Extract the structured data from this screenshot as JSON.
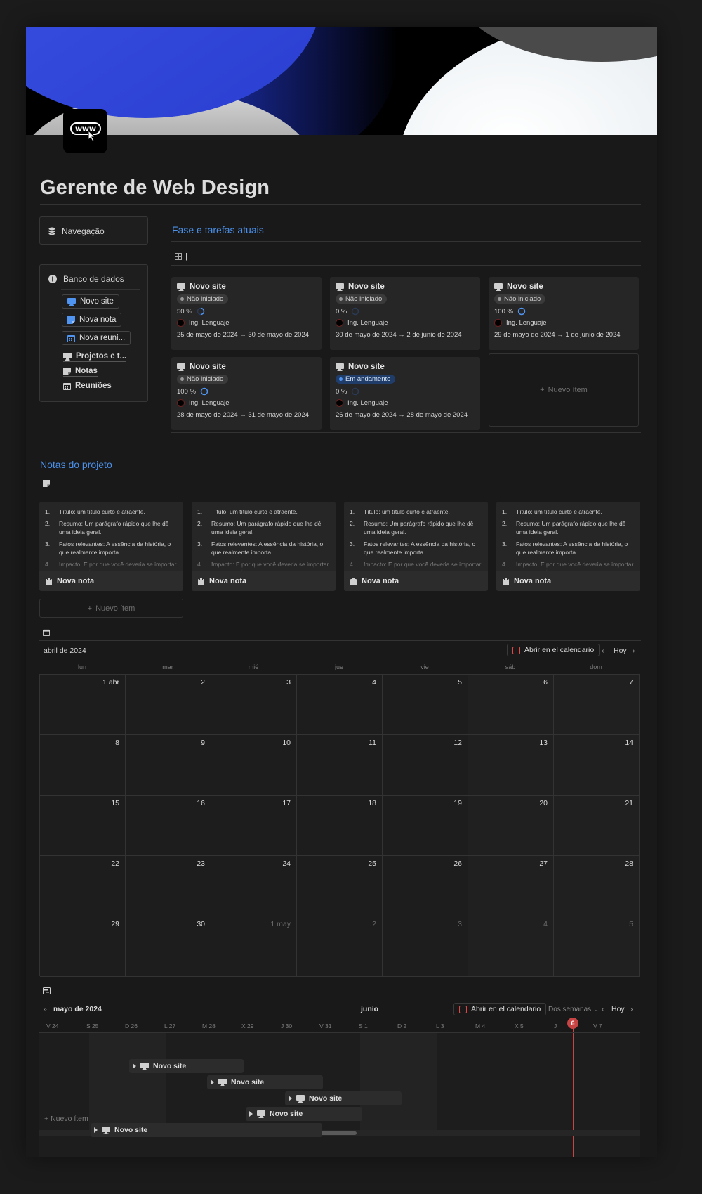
{
  "page": {
    "title": "Gerente de Web Design",
    "icon": "www-cursor-icon"
  },
  "sidebar": {
    "nav_label": "Navegação",
    "db_label": "Banco de dados",
    "buttons": [
      {
        "label": "Novo site",
        "icon": "monitor-icon",
        "color": "#4f94f0"
      },
      {
        "label": "Nova nota",
        "icon": "note-icon",
        "color": "#4f94f0"
      },
      {
        "label": "Nova reuni...",
        "icon": "calendar-icon",
        "color": "#4f94f0"
      }
    ],
    "links": [
      {
        "label": "Projetos e t...",
        "icon": "monitor-icon"
      },
      {
        "label": "Notas",
        "icon": "note-icon"
      },
      {
        "label": "Reuniões",
        "icon": "calendar-icon"
      }
    ]
  },
  "tasks": {
    "title": "Fase e tarefas atuais",
    "view_label": "|",
    "new_item": "Nuevo ítem",
    "cards": [
      {
        "title": "Novo site",
        "status": "Não iniciado",
        "progress": "50 %",
        "progress_value": 0.5,
        "person": "Ing. Lenguaje",
        "dates": "25 de mayo de 2024 → 30 de mayo de 2024"
      },
      {
        "title": "Novo site",
        "status": "Não iniciado",
        "progress": "0 %",
        "progress_value": 0,
        "person": "Ing. Lenguaje",
        "dates": "30 de mayo de 2024 → 2 de junio de 2024"
      },
      {
        "title": "Novo site",
        "status": "Não iniciado",
        "progress": "100 %",
        "progress_value": 1,
        "person": "Ing. Lenguaje",
        "dates": "29 de mayo de 2024 → 1 de junio de 2024"
      },
      {
        "title": "Novo site",
        "status": "Não iniciado",
        "progress": "100 %",
        "progress_value": 1,
        "person": "Ing. Lenguaje",
        "dates": "28 de mayo de 2024 → 31 de mayo de 2024"
      },
      {
        "title": "Novo site",
        "status": "Em andamento",
        "progress": "0 %",
        "progress_value": 0,
        "person": "Ing. Lenguaje",
        "dates": "26 de mayo de 2024 → 28 de mayo de 2024"
      }
    ]
  },
  "notes": {
    "title": "Notas do projeto",
    "new_item": "Nuevo ítem",
    "items": [
      {
        "n": "1.",
        "label": "Título:",
        "text": "um título curto e atraente."
      },
      {
        "n": "2.",
        "label": "Resumo:",
        "text": "Um parágrafo rápido que lhe dê uma ideia geral."
      },
      {
        "n": "3.",
        "label": "Fatos relevantes:",
        "text": "A essência da história, o que realmente importa."
      },
      {
        "n": "4.",
        "label": "Impacto:",
        "text": "E por que você deveria se importar com isso? É aqui que dizemos a você."
      }
    ],
    "cards": [
      {
        "footer": "Nova nota"
      },
      {
        "footer": "Nova nota"
      },
      {
        "footer": "Nova nota"
      },
      {
        "footer": "Nova nota"
      }
    ]
  },
  "calendar": {
    "month": "abril de 2024",
    "open_btn": "Abrir en el calendario",
    "today": "Hoy",
    "weekdays": [
      "lun",
      "mar",
      "mié",
      "jue",
      "vie",
      "sáb",
      "dom"
    ],
    "days": [
      "1 abr",
      "2",
      "3",
      "4",
      "5",
      "6",
      "7",
      "8",
      "9",
      "10",
      "11",
      "12",
      "13",
      "14",
      "15",
      "16",
      "17",
      "18",
      "19",
      "20",
      "21",
      "22",
      "23",
      "24",
      "25",
      "26",
      "27",
      "28",
      "29",
      "30",
      "1 may",
      "2",
      "3",
      "4",
      "5"
    ],
    "outside_from": 30
  },
  "timeline": {
    "view_label": "|",
    "month_left": "mayo de 2024",
    "month_mid": "junio",
    "open_btn": "Abrir en el calendario",
    "range": "Dos semanas",
    "today": "Hoy",
    "today_day": "6",
    "new_item": "Nuevo ítem",
    "days": [
      "V 24",
      "S 25",
      "D 26",
      "L 27",
      "M 28",
      "X 29",
      "J 30",
      "V 31",
      "S 1",
      "D 2",
      "L 3",
      "M 4",
      "X 5",
      "J",
      "V 7"
    ],
    "bars": [
      {
        "label": "Novo site"
      },
      {
        "label": "Novo site"
      },
      {
        "label": "Novo site"
      },
      {
        "label": "Novo site"
      },
      {
        "label": "Novo site"
      }
    ]
  }
}
